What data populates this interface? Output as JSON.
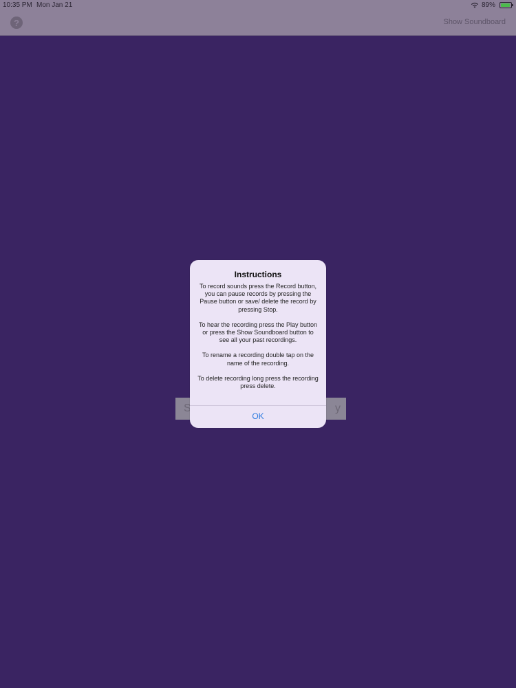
{
  "status_bar": {
    "time": "10:35 PM",
    "date": "Mon Jan 21",
    "battery": "89%"
  },
  "nav": {
    "help_label": "?",
    "show_soundboard_label": "Show Soundboard"
  },
  "background_buttons": {
    "left_label": "S",
    "right_label": "y"
  },
  "alert": {
    "title": "Instructions",
    "paragraphs": [
      "To record sounds press the Record button, you can pause records by pressing the Pause button or save/ delete the record by pressing Stop.",
      "To hear the recording press the Play button or press the Show Soundboard button to see all your past recordings.",
      "To rename a recording double tap on the name of the recording.",
      "To delete recording long press the recording press delete."
    ],
    "ok_label": "OK"
  },
  "colors": {
    "background": "#3a2462",
    "accent": "#2d7be0"
  }
}
